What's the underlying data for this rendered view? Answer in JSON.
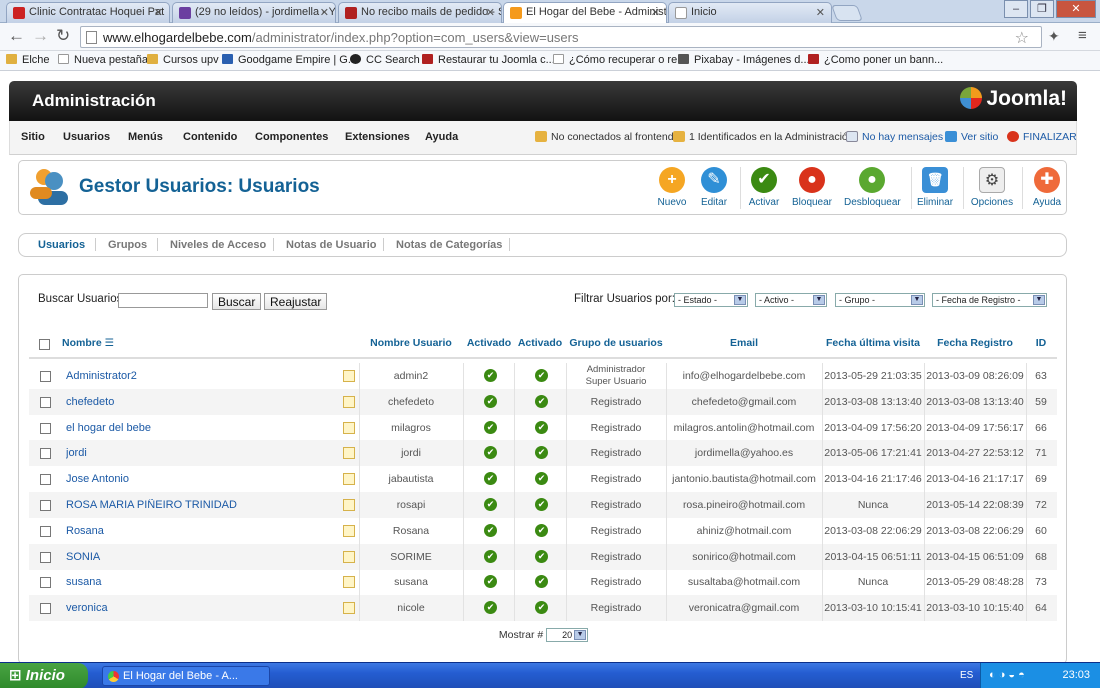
{
  "browser": {
    "tabs": [
      {
        "label": "Clinic Contratac Hoquei Pat",
        "color": "#cc2222"
      },
      {
        "label": "(29 no leídos) - jordimella - Y",
        "color": "#6b3fa0"
      },
      {
        "label": "No recibo mails de pedido - S",
        "color": "#b02020"
      },
      {
        "label": "El Hogar del Bebe - Administr",
        "color": "#f59a1c"
      },
      {
        "label": "Inicio",
        "color": "#ffffff"
      }
    ],
    "tab_close": "✕",
    "window_buttons": [
      "–",
      "❐",
      "✕"
    ],
    "url_host": "www.elhogardelbebe.com",
    "url_path": "/administrator/index.php?option=com_users&view=users",
    "bookmarks": [
      {
        "label": "Elche",
        "color": "#e0b040"
      },
      {
        "label": "Nueva pestaña",
        "color": "#ffffff"
      },
      {
        "label": "Cursos upv",
        "color": "#e0b040"
      },
      {
        "label": "Goodgame Empire | G...",
        "color": "#2a5fb0"
      },
      {
        "label": "CC Search",
        "color": "#222222"
      },
      {
        "label": "Restaurar tu Joomla c...",
        "color": "#b02020"
      },
      {
        "label": "¿Cómo recuperar o re...",
        "color": "#ffffff"
      },
      {
        "label": "Pixabay - Imágenes d...",
        "color": "#555555"
      },
      {
        "label": "¿Como poner un bann...",
        "color": "#b02020"
      }
    ]
  },
  "admin": {
    "header_title": "Administración",
    "logo_text": "Joomla!",
    "menu": [
      "Sitio",
      "Usuarios",
      "Menús",
      "Contenido",
      "Componentes",
      "Extensiones",
      "Ayuda"
    ],
    "status": {
      "frontend": "No conectados al frontend",
      "admin": "1 Identificados en la Administración",
      "messages": "No hay mensajes",
      "view_site": "Ver sitio",
      "logout": "FINALIZAR"
    },
    "page_title": "Gestor Usuarios: Usuarios",
    "toolbar": [
      {
        "label": "Nuevo",
        "color": "#f5a623",
        "glyph": "+"
      },
      {
        "label": "Editar",
        "color": "#2f8fd6",
        "glyph": "✎"
      },
      {
        "label": "Activar",
        "color": "#3b8a12",
        "glyph": "✔"
      },
      {
        "label": "Bloquear",
        "color": "#d9331b",
        "glyph": "●"
      },
      {
        "label": "Desbloquear",
        "color": "#5aa830",
        "glyph": "●"
      },
      {
        "label": "Eliminar",
        "color": "#3a8fd6",
        "glyph": "🗑"
      },
      {
        "label": "Opciones",
        "color": "#e8e8e8",
        "glyph": "⚙"
      },
      {
        "label": "Ayuda",
        "color": "#ef6a3a",
        "glyph": "✚"
      }
    ],
    "subnav": [
      "Usuarios",
      "Grupos",
      "Niveles de Acceso",
      "Notas de Usuario",
      "Notas de Categorías"
    ]
  },
  "filters": {
    "search_label": "Buscar Usuarios",
    "search_button": "Buscar",
    "reset_button": "Reajustar",
    "filter_label": "Filtrar Usuarios por:",
    "selects": [
      "- Estado -",
      "- Activo -",
      "- Grupo -",
      "- Fecha de Registro -"
    ]
  },
  "table": {
    "columns": [
      "Nombre",
      "Nombre Usuario",
      "Activado",
      "Activado",
      "Grupo de usuarios",
      "Email",
      "Fecha última visita",
      "Fecha Registro",
      "ID"
    ],
    "rows": [
      {
        "name": "Administrator2",
        "username": "admin2",
        "enabled": "✔",
        "activated": "✔",
        "group": "Administrador\nSuper Usuario",
        "email": "info@elhogardelbebe.com",
        "last_visit": "2013-05-29 21:03:35",
        "registered": "2013-03-09 08:26:09",
        "id": "63"
      },
      {
        "name": "chefedeto",
        "username": "chefedeto",
        "enabled": "✔",
        "activated": "✔",
        "group": "Registrado",
        "email": "chefedeto@gmail.com",
        "last_visit": "2013-03-08 13:13:40",
        "registered": "2013-03-08 13:13:40",
        "id": "59"
      },
      {
        "name": "el hogar del bebe",
        "username": "milagros",
        "enabled": "✔",
        "activated": "✔",
        "group": "Registrado",
        "email": "milagros.antolin@hotmail.com",
        "last_visit": "2013-04-09 17:56:20",
        "registered": "2013-04-09 17:56:17",
        "id": "66"
      },
      {
        "name": "jordi",
        "username": "jordi",
        "enabled": "✔",
        "activated": "✔",
        "group": "Registrado",
        "email": "jordimella@yahoo.es",
        "last_visit": "2013-05-06 17:21:41",
        "registered": "2013-04-27 22:53:12",
        "id": "71"
      },
      {
        "name": "Jose Antonio",
        "username": "jabautista",
        "enabled": "✔",
        "activated": "✔",
        "group": "Registrado",
        "email": "jantonio.bautista@hotmail.com",
        "last_visit": "2013-04-16 21:17:46",
        "registered": "2013-04-16 21:17:17",
        "id": "69"
      },
      {
        "name": "ROSA MARIA PIÑEIRO TRINIDAD",
        "username": "rosapi",
        "enabled": "✔",
        "activated": "✔",
        "group": "Registrado",
        "email": "rosa.pineiro@hotmail.com",
        "last_visit": "Nunca",
        "registered": "2013-05-14 22:08:39",
        "id": "72"
      },
      {
        "name": "Rosana",
        "username": "Rosana",
        "enabled": "✔",
        "activated": "✔",
        "group": "Registrado",
        "email": "ahiniz@hotmail.com",
        "last_visit": "2013-03-08 22:06:29",
        "registered": "2013-03-08 22:06:29",
        "id": "60"
      },
      {
        "name": "SONIA",
        "username": "SORIME",
        "enabled": "✔",
        "activated": "✔",
        "group": "Registrado",
        "email": "sonirico@hotmail.com",
        "last_visit": "2013-04-15 06:51:11",
        "registered": "2013-04-15 06:51:09",
        "id": "68"
      },
      {
        "name": "susana",
        "username": "susana",
        "enabled": "✔",
        "activated": "✔",
        "group": "Registrado",
        "email": "susaltaba@hotmail.com",
        "last_visit": "Nunca",
        "registered": "2013-05-29 08:48:28",
        "id": "73"
      },
      {
        "name": "veronica",
        "username": "nicole",
        "enabled": "✔",
        "activated": "✔",
        "group": "Registrado",
        "email": "veronicatra@gmail.com",
        "last_visit": "2013-03-10 10:15:41",
        "registered": "2013-03-10 10:15:40",
        "id": "64"
      }
    ],
    "show_label": "Mostrar #",
    "show_value": "20"
  },
  "taskbar": {
    "start": "Inicio",
    "task": "El Hogar del Bebe - A...",
    "lang": "ES",
    "clock": "23:03"
  }
}
